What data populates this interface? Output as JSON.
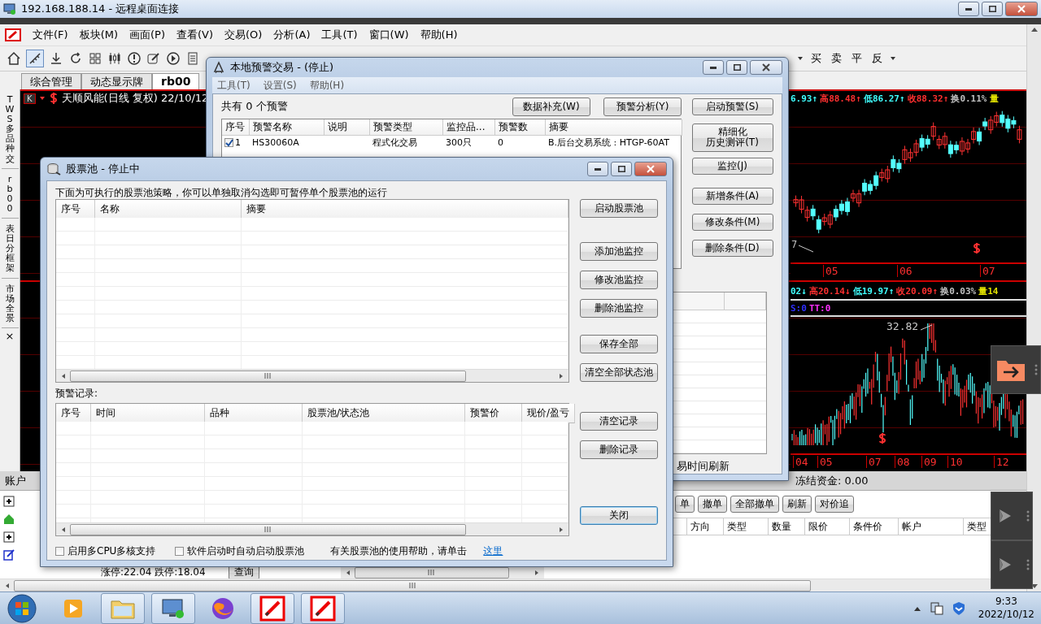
{
  "remote_window": {
    "title": "192.168.188.14 - 远程桌面连接"
  },
  "app": {
    "menu": [
      "文件(F)",
      "板块(M)",
      "画面(P)",
      "查看(V)",
      "交易(O)",
      "分析(A)",
      "工具(T)",
      "窗口(W)",
      "帮助(H)"
    ],
    "trade_buttons": [
      "买",
      "卖",
      "平",
      "反"
    ],
    "tabs": [
      {
        "label": "综合管理",
        "selected": false
      },
      {
        "label": "动态显示牌",
        "selected": false
      },
      {
        "label": "rb00",
        "selected": true
      }
    ],
    "side_tabs": [
      {
        "label": "TWS多品种交",
        "selected": false
      },
      {
        "label": "rb00",
        "selected": false
      },
      {
        "label": "表日分框架",
        "selected": false
      },
      {
        "label": "市场全景",
        "selected": false
      }
    ],
    "side_close": "×",
    "upper_chart": {
      "k_label": "K",
      "title": "天顺风能(日线 复权) 22/10/12",
      "quote": [
        {
          "text": "6.93↑",
          "color": "#40ffff"
        },
        {
          "text": "高88.48↑",
          "color": "#ff3030"
        },
        {
          "text": "低86.27↑",
          "color": "#40ffff"
        },
        {
          "text": "收88.32↑",
          "color": "#ff3030"
        },
        {
          "text": "换0.11%",
          "color": "#c0c0c0"
        },
        {
          "text": "量",
          "color": "#e0e000"
        }
      ],
      "low_label": "7",
      "x_labels": [
        "05",
        "06",
        "07"
      ]
    },
    "lower_chart": {
      "quote": [
        {
          "text": "02↓",
          "color": "#40ffff"
        },
        {
          "text": "高20.14↓",
          "color": "#ff3030"
        },
        {
          "text": "低19.97↑",
          "color": "#40ffff"
        },
        {
          "text": "收20.09↑",
          "color": "#ff3030"
        },
        {
          "text": "换0.03%",
          "color": "#c0c0c0"
        },
        {
          "text": "量14",
          "color": "#e0e000"
        }
      ],
      "indicators": [
        {
          "text": "S:0",
          "color": "#3030ff"
        },
        {
          "text": "TT:0",
          "color": "#ff30ff"
        }
      ],
      "peak_label": "32.82",
      "x_labels": [
        "04",
        "05",
        "07",
        "08",
        "09",
        "10",
        "12"
      ]
    },
    "bottom_panel": {
      "title": "账户",
      "frozen_funds": "冻结资金: 0.00",
      "buttons": [
        "单",
        "撤单",
        "全部撤单",
        "刷新",
        "对价追"
      ],
      "columns": [
        "方向",
        "类型",
        "数量",
        "限价",
        "条件价",
        "帐户",
        "类型"
      ],
      "limit_text": "涨停:22.04 跌停:18.04",
      "query_button": "查询"
    }
  },
  "alert_window": {
    "title": "本地预警交易 - (停止)",
    "menu": [
      "工具(T)",
      "设置(S)",
      "帮助(H)"
    ],
    "summary": "共有 0 个预警",
    "top_buttons": [
      "数据补充(W)",
      "预警分析(Y)"
    ],
    "side_buttons": [
      [
        "启动预警(S)"
      ],
      [
        "精细化",
        "历史测评(T)"
      ],
      [
        "监控(J)"
      ],
      [
        "新增条件(A)"
      ],
      [
        "修改条件(M)"
      ],
      [
        "删除条件(D)"
      ]
    ],
    "columns": [
      "序号",
      "预警名称",
      "说明",
      "预警类型",
      "监控品...",
      "预警数",
      "摘要"
    ],
    "rows": [
      {
        "checked": true,
        "index": "1",
        "name": "HS30060A",
        "type": "程式化交易",
        "monitored": "300只",
        "alert_count": "0",
        "summary": "B.后台交易系统 : HTGP-60AT"
      }
    ],
    "refresh_note": "易时间刷新"
  },
  "pool_window": {
    "title": "股票池 - 停止中",
    "description": "下面为可执行的股票池策略，你可以单独取消勾选即可暂停单个股票池的运行",
    "pool_columns": [
      "序号",
      "名称",
      "摘要"
    ],
    "pool_buttons": [
      "启动股票池",
      "添加池监控",
      "修改池监控",
      "删除池监控",
      "保存全部",
      "清空全部状态池"
    ],
    "records_label": "预警记录:",
    "record_columns": [
      "序号",
      "时间",
      "品种",
      "股票池/状态池",
      "预警价",
      "现价/盈亏"
    ],
    "record_buttons": [
      "清空记录",
      "删除记录"
    ],
    "close_button": "关闭",
    "options": [
      {
        "label": "启用多CPU多核支持",
        "checked": false
      },
      {
        "label": "软件启动时自动启动股票池",
        "checked": false
      }
    ],
    "help_text": "有关股票池的使用帮助，请单击",
    "help_link": "这里"
  },
  "taskbar": {
    "time": "9:33",
    "date": "2022/10/12"
  }
}
